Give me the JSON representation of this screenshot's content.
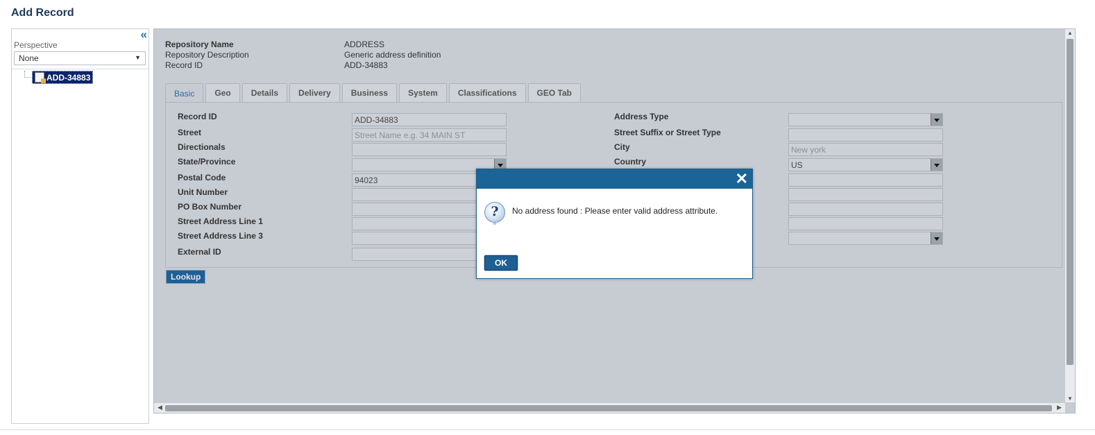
{
  "page": {
    "title": "Add Record"
  },
  "sidebar": {
    "collapse_icon": "double-chevron-left-icon",
    "perspective_label": "Perspective",
    "perspective_value": "None",
    "tree": {
      "node_label": "ADD-34883",
      "node_icon": "record-icon"
    }
  },
  "info": {
    "repo_name_label": "Repository Name",
    "repo_name_value": "ADDRESS",
    "repo_desc_label": "Repository Description",
    "repo_desc_value": "Generic address definition",
    "record_id_label": "Record ID",
    "record_id_value": "ADD-34883"
  },
  "tabs": [
    "Basic",
    "Geo",
    "Details",
    "Delivery",
    "Business",
    "System",
    "Classifications",
    "GEO Tab"
  ],
  "active_tab": "Basic",
  "form": {
    "left": {
      "record_id": {
        "label": "Record ID",
        "value": "ADD-34883"
      },
      "street": {
        "label": "Street",
        "placeholder": "Street Name e.g. 34 MAIN ST"
      },
      "directionals": {
        "label": "Directionals",
        "value": ""
      },
      "state": {
        "label": "State/Province",
        "value": ""
      },
      "postal_code": {
        "label": "Postal Code",
        "value": "94023"
      },
      "unit_number": {
        "label": "Unit Number",
        "value": ""
      },
      "po_box": {
        "label": "PO Box Number",
        "value": ""
      },
      "line1": {
        "label": "Street Address Line 1",
        "value": ""
      },
      "line3": {
        "label": "Street Address Line 3",
        "value": ""
      },
      "external_id": {
        "label": "External ID",
        "value": ""
      }
    },
    "right": {
      "address_type": {
        "label": "Address Type",
        "value": ""
      },
      "street_suffix": {
        "label": "Street Suffix or Street Type",
        "value": ""
      },
      "city": {
        "label": "City",
        "placeholder": "New york"
      },
      "country": {
        "label": "Country",
        "value": "US"
      }
    }
  },
  "lookup_label": "Lookup",
  "dialog": {
    "close_icon": "close-icon",
    "icon": "question-icon",
    "message": "No address found : Please enter valid address attribute.",
    "ok_label": "OK"
  },
  "colors": {
    "header_blue": "#1a6496",
    "panel_gray": "#c7ccd3",
    "tab_active_text": "#2c6aa8",
    "tree_selected": "#0a246a"
  }
}
